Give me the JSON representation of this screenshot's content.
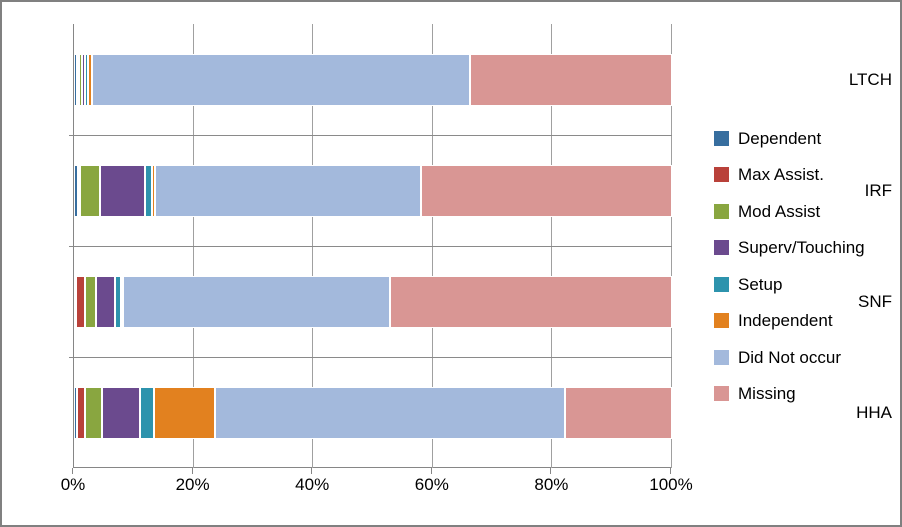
{
  "chart_data": {
    "type": "bar",
    "orientation": "horizontal",
    "stacked": true,
    "stack_mode": "percent",
    "title": "",
    "xlabel": "",
    "ylabel": "",
    "xlim": [
      0,
      100
    ],
    "x_tick_labels": [
      "0%",
      "20%",
      "40%",
      "60%",
      "80%",
      "100%"
    ],
    "x_tick_values": [
      0,
      20,
      40,
      60,
      80,
      100
    ],
    "grid": true,
    "legend_position": "right",
    "categories": [
      "LTCH",
      "IRF",
      "SNF",
      "HHA"
    ],
    "series": [
      {
        "name": "Dependent",
        "color": "#376e9f",
        "values": [
          0.5,
          0.6,
          0.3,
          0.5
        ]
      },
      {
        "name": "Max Assist.",
        "color": "#b9413a",
        "values": [
          0.4,
          0.4,
          1.5,
          1.4
        ]
      },
      {
        "name": "Mod Assist",
        "color": "#89a640",
        "values": [
          0.5,
          3.4,
          1.8,
          2.8
        ]
      },
      {
        "name": "Superv/Touching",
        "color": "#6b4a8e",
        "values": [
          0.5,
          7.5,
          3.2,
          6.3
        ]
      },
      {
        "name": "Setup",
        "color": "#2d93ad",
        "values": [
          0.4,
          1.2,
          1.0,
          2.4
        ]
      },
      {
        "name": "Independent",
        "color": "#e2811f",
        "values": [
          0.7,
          0.4,
          0.3,
          10.2
        ]
      },
      {
        "name": "Did Not occur",
        "color": "#a3b9dc",
        "values": [
          63.2,
          44.6,
          44.7,
          58.5
        ]
      },
      {
        "name": "Missing",
        "color": "#d99694",
        "values": [
          33.8,
          41.9,
          47.2,
          17.9
        ]
      }
    ]
  },
  "axis": {
    "category_labels": [
      "LTCH",
      "IRF",
      "SNF",
      "HHA"
    ],
    "x_labels": [
      "0%",
      "20%",
      "40%",
      "60%",
      "80%",
      "100%"
    ]
  },
  "legend": {
    "items": [
      {
        "label": "Dependent",
        "color": "#376e9f"
      },
      {
        "label": "Max Assist.",
        "color": "#b9413a"
      },
      {
        "label": "Mod Assist",
        "color": "#89a640"
      },
      {
        "label": "Superv/Touching",
        "color": "#6b4a8e"
      },
      {
        "label": "Setup",
        "color": "#2d93ad"
      },
      {
        "label": "Independent",
        "color": "#e2811f"
      },
      {
        "label": "Did Not occur",
        "color": "#a3b9dc"
      },
      {
        "label": "Missing",
        "color": "#d99694"
      }
    ]
  }
}
